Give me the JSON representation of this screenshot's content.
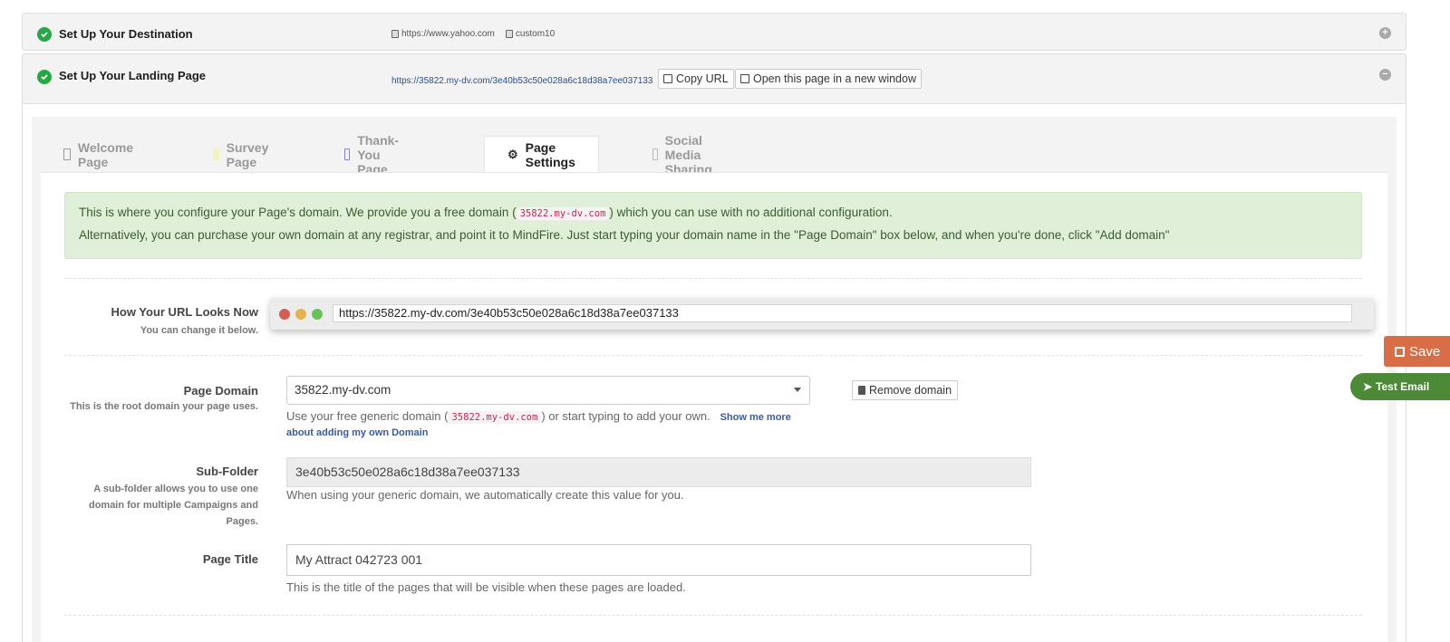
{
  "destination_panel": {
    "title": "Set Up Your Destination",
    "url": "https://www.yahoo.com",
    "tag": "custom10",
    "toggle": "+"
  },
  "landing_panel": {
    "title": "Set Up Your Landing Page",
    "url": "https://35822.my-dv.com/3e40b53c50e028a6c18d38a7ee037133",
    "copy_url_label": "Copy URL",
    "open_window_label": "Open this page in a new window",
    "toggle": "−"
  },
  "tabs": [
    {
      "label": "Welcome Page",
      "icon": "document-icon"
    },
    {
      "label": "Survey Page",
      "icon": "note-icon"
    },
    {
      "label": "Thank-You Page",
      "icon": "document-icon"
    },
    {
      "label": "Page Settings",
      "icon": "gears-icon",
      "active": true
    },
    {
      "label": "Social Media Sharing",
      "icon": "share-icon"
    }
  ],
  "alert": {
    "line1_pre": "This is where you configure your Page's domain. We provide you a free domain (",
    "line1_code": "35822.my-dv.com",
    "line1_post": ") which you can use with no additional configuration.",
    "line2": "Alternatively, you can purchase your own domain at any registrar, and point it to MindFire. Just start typing your domain name in the \"Page Domain\" box below, and when you're done, click \"Add domain\""
  },
  "url_preview": {
    "label": "How Your URL Looks Now",
    "sublabel": "You can change it below.",
    "value": "https://35822.my-dv.com/3e40b53c50e028a6c18d38a7ee037133"
  },
  "page_domain": {
    "label": "Page Domain",
    "sublabel": "This is the root domain your page uses.",
    "value": "35822.my-dv.com",
    "remove_label": "Remove domain",
    "help_pre": "Use your free generic domain (",
    "help_code": "35822.my-dv.com",
    "help_post": ") or start typing to add your own.",
    "help_link_1": "Show me more",
    "help_link_2": "about adding my own Domain"
  },
  "sub_folder": {
    "label": "Sub-Folder",
    "sublabel_1": "A sub-folder allows you to use one",
    "sublabel_2": "domain for multiple Campaigns and",
    "sublabel_3": "Pages.",
    "value": "3e40b53c50e028a6c18d38a7ee037133",
    "help": "When using your generic domain, we automatically create this value for you."
  },
  "page_title": {
    "label": "Page Title",
    "value": "My Attract 042723 001",
    "help": "This is the title of the pages that will be visible when these pages are loaded."
  },
  "floating": {
    "save_label": "Save",
    "test_email_label": "Test Email"
  },
  "colors": {
    "check_green": "#27a745",
    "save_orange": "#d86e48",
    "test_green": "#4d8a38",
    "alert_bg": "#dfefd8"
  }
}
